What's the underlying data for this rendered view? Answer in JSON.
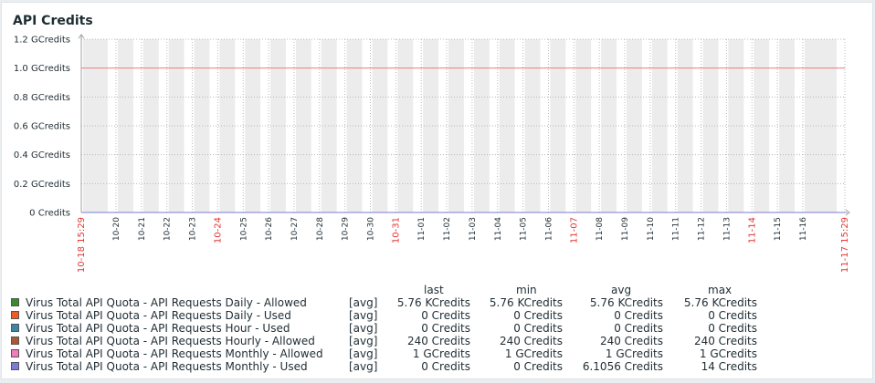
{
  "widget": {
    "title": "API Credits"
  },
  "chart_data": {
    "type": "line",
    "title": "API Credits",
    "y_ticks": [
      "0 Credits",
      "0.2 GCredits",
      "0.4 GCredits",
      "0.6 GCredits",
      "0.8 GCredits",
      "1.0 GCredits",
      "1.2 GCredits"
    ],
    "ylim": [
      0,
      1.2
    ],
    "y_unit": "GCredits",
    "x_range": [
      "10-18 15:29",
      "11-17 15:29"
    ],
    "x_ticks": [
      "10-18 15:29",
      "10-20",
      "10-21",
      "10-22",
      "10-23",
      "10-24",
      "10-25",
      "10-26",
      "10-27",
      "10-28",
      "10-29",
      "10-30",
      "10-31",
      "11-01",
      "11-02",
      "11-03",
      "11-04",
      "11-05",
      "11-06",
      "11-07",
      "11-08",
      "11-09",
      "11-10",
      "11-11",
      "11-12",
      "11-13",
      "11-14",
      "11-15",
      "11-16",
      "11-17 15:29"
    ],
    "x_ticks_red": [
      "10-18 15:29",
      "10-24",
      "10-31",
      "11-07",
      "11-14",
      "11-17 15:29"
    ],
    "grid": true,
    "series": [
      {
        "name": "Virus Total API Quota - API Requests Daily - Allowed",
        "color": "#3a8a30",
        "values": [
          5.76e-06
        ]
      },
      {
        "name": "Virus Total API Quota - API Requests Daily - Used",
        "color": "#f05a24",
        "values": [
          0
        ]
      },
      {
        "name": "Virus Total API Quota - API Requests Hour - Used",
        "color": "#3a85a8",
        "values": [
          0
        ]
      },
      {
        "name": "Virus Total API Quota - API Requests Hourly - Allowed",
        "color": "#a85a35",
        "values": [
          2.4e-07
        ]
      },
      {
        "name": "Virus Total API Quota - API Requests Monthly - Allowed",
        "color": "#f27bbd",
        "values": [
          1.0
        ]
      },
      {
        "name": "Virus Total API Quota - API Requests Monthly  - Used",
        "color": "#7b7bd9",
        "values": [
          0
        ]
      }
    ]
  },
  "legend": {
    "headers": {
      "last": "last",
      "min": "min",
      "avg": "avg",
      "max": "max"
    },
    "rows": [
      {
        "swatch": "#3a8a30",
        "name": "Virus Total API Quota - API Requests Daily - Allowed",
        "func": "[avg]",
        "last": "5.76 KCredits",
        "min": "5.76 KCredits",
        "avg": "5.76 KCredits",
        "max": "5.76 KCredits"
      },
      {
        "swatch": "#f05a24",
        "name": "Virus Total API Quota - API Requests Daily - Used",
        "func": "[avg]",
        "last": "0 Credits",
        "min": "0 Credits",
        "avg": "0 Credits",
        "max": "0 Credits"
      },
      {
        "swatch": "#3a85a8",
        "name": "Virus Total API Quota - API Requests Hour - Used",
        "func": "[avg]",
        "last": "0 Credits",
        "min": "0 Credits",
        "avg": "0 Credits",
        "max": "0 Credits"
      },
      {
        "swatch": "#a85a35",
        "name": "Virus Total API Quota - API Requests Hourly - Allowed",
        "func": "[avg]",
        "last": "240 Credits",
        "min": "240 Credits",
        "avg": "240 Credits",
        "max": "240 Credits"
      },
      {
        "swatch": "#f27bbd",
        "name": "Virus Total API Quota - API Requests Monthly - Allowed",
        "func": "[avg]",
        "last": "1 GCredits",
        "min": "1 GCredits",
        "avg": "1 GCredits",
        "max": "1 GCredits"
      },
      {
        "swatch": "#7b7bd9",
        "name": "Virus Total API Quota - API Requests Monthly  - Used",
        "func": "[avg]",
        "last": "0 Credits",
        "min": "0 Credits",
        "avg": "6.1056 Credits",
        "max": "14 Credits"
      }
    ]
  }
}
